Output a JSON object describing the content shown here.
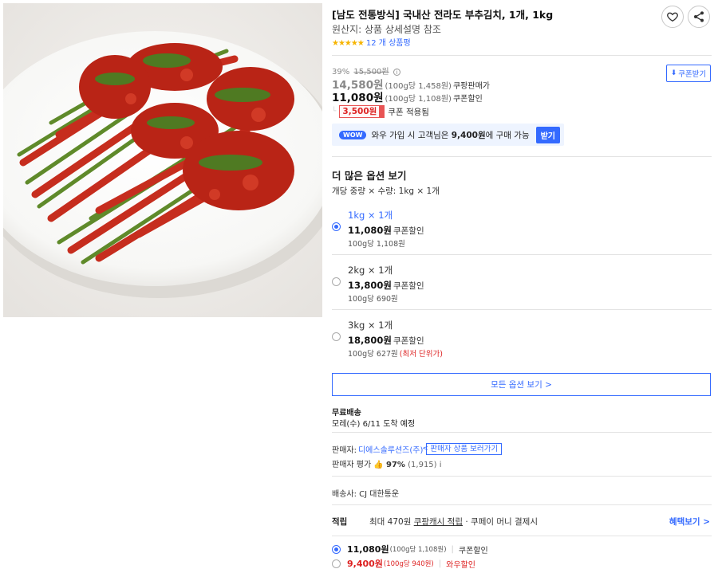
{
  "product": {
    "title": "[남도 전통방식] 국내산 전라도 부추김치, 1개, 1kg",
    "origin": "원산지: 상품 상세설명 참조",
    "stars": "★★★★★",
    "review_count": "12 개 상품평"
  },
  "actions": {
    "heart_icon": "heart-icon",
    "share_icon": "share-icon"
  },
  "pricing": {
    "discount_rate": "39%",
    "original_price": "15,500원",
    "info_glyph": "i",
    "coupang_price": "14,580원",
    "coupang_unit": "(100g당 1,458원)",
    "coupang_label": "쿠팡판매가",
    "coupon_price": "11,080원",
    "coupon_unit": "(100g당 1,108원)",
    "coupon_label": "쿠폰할인",
    "coupon_get_label": "쿠폰받기",
    "coupon_amount": "3,500원",
    "coupon_applied_label": "쿠폰 적용됨"
  },
  "wow": {
    "badge": "WOW",
    "text_prefix": "와우 가입 시 고객님은",
    "text_price": "9,400원",
    "text_suffix": "에 구매 가능",
    "button": "받기"
  },
  "options": {
    "heading": "더 많은 옵션 보기",
    "unit_line": "개당 중량 × 수량: 1kg × 1개",
    "items": [
      {
        "name": "1kg × 1개",
        "price": "11,080원",
        "price_label": "쿠폰할인",
        "unit": "100g당 1,108원",
        "note": "",
        "selected": true
      },
      {
        "name": "2kg × 1개",
        "price": "13,800원",
        "price_label": "쿠폰할인",
        "unit": "100g당 690원",
        "note": "",
        "selected": false
      },
      {
        "name": "3kg × 1개",
        "price": "18,800원",
        "price_label": "쿠폰할인",
        "unit": "100g당 627원",
        "note": "(최저 단위가)",
        "selected": false
      }
    ],
    "all_button": "모든 옵션 보기 >"
  },
  "shipping": {
    "title": "무료배송",
    "date": "모레(수) 6/11 도착 예정"
  },
  "seller": {
    "label": "판매자:",
    "name": "디에스솔루션즈(주)",
    "link": "판매자 상품 보러가기",
    "rating_label": "판매자 평가",
    "thumb": "👍",
    "rating_value": "97%",
    "rating_count": "(1,915)",
    "rating_info": "i",
    "carrier": "배송사: CJ 대한통운"
  },
  "points": {
    "label": "적립",
    "max": "최대 470원",
    "cash": "쿠팡캐시 적립",
    "pay": "· 쿠페이 머니 결제시",
    "benefit": "혜택보기 >"
  },
  "bottom_options": [
    {
      "price": "11,080원",
      "unit": "(100g당 1,108원)",
      "tag": "쿠폰할인",
      "selected": true
    },
    {
      "price": "9,400원",
      "unit": "(100g당 940원)",
      "tag": "와우할인",
      "selected": false
    }
  ],
  "colors": {
    "accent": "#346aff",
    "sale": "#d22222",
    "star": "#f6b400"
  }
}
